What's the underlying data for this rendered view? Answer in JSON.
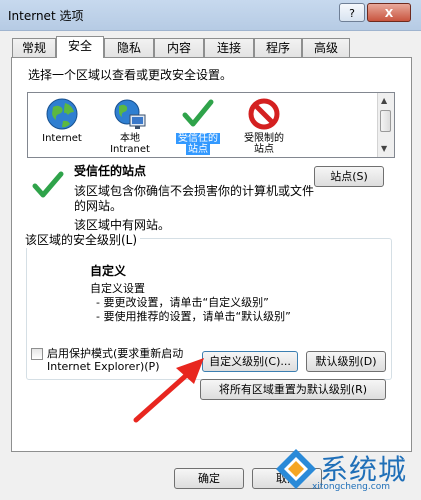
{
  "window": {
    "title": "Internet 选项",
    "help_label": "?",
    "close_label": "X"
  },
  "tabs": [
    {
      "label": "常规"
    },
    {
      "label": "安全"
    },
    {
      "label": "隐私"
    },
    {
      "label": "内容"
    },
    {
      "label": "连接"
    },
    {
      "label": "程序"
    },
    {
      "label": "高级"
    }
  ],
  "security": {
    "zone_prompt": "选择一个区域以查看或更改安全设置。",
    "zones": [
      {
        "line1": "Internet",
        "line2": "",
        "icon": "globe-icon"
      },
      {
        "line1": "本地",
        "line2": "Intranet",
        "icon": "intranet-icon"
      },
      {
        "line1": "受信任的",
        "line2": "站点",
        "icon": "checkmark-icon"
      },
      {
        "line1": "受限制的",
        "line2": "站点",
        "icon": "restricted-icon"
      }
    ],
    "selected_zone_index": 2,
    "selected_title": "受信任的站点",
    "sites_button": "站点(S)",
    "desc": "该区域包含你确信不会损害你的计算机或文件的网站。",
    "note": "该区域中有网站。",
    "level_group_label": "该区域的安全级别(L)",
    "level_name": "自定义",
    "level_lines": [
      "自定义设置",
      "- 要更改设置，请单击“自定义级别”",
      "- 要使用推荐的设置，请单击“默认级别”"
    ],
    "protected_mode": {
      "line1": "启用保护模式(要求重新启动",
      "line2": "Internet Explorer)(P)",
      "checked": false
    },
    "custom_level_button": "自定义级别(C)...",
    "default_level_button": "默认级别(D)",
    "reset_all_button": "将所有区域重置为默认级别(R)"
  },
  "footer": {
    "ok_button": "确定",
    "cancel_button": "取消"
  },
  "watermark": {
    "text": "系统城",
    "url": "xitongcheng.com"
  },
  "colors": {
    "selection": "#3399ff",
    "annotation_arrow": "#e8261f",
    "watermark": "#1f6fb8"
  }
}
